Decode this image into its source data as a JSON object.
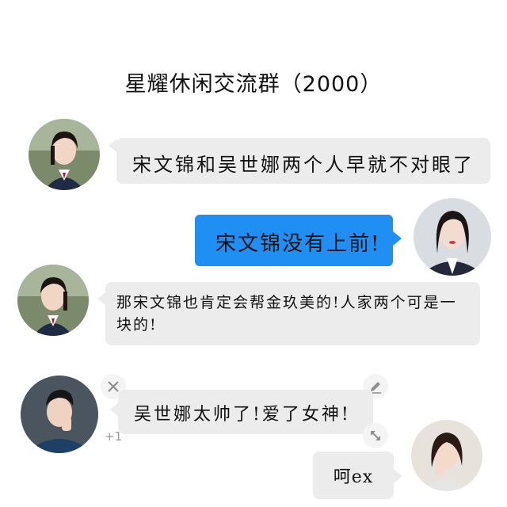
{
  "header": {
    "title": "星耀休闲交流群（2000）"
  },
  "messages": [
    {
      "side": "left",
      "text": "宋文锦和吴世娜两个人早就不对眼了"
    },
    {
      "side": "right",
      "text": "宋文锦没有上前!"
    },
    {
      "side": "left",
      "text": "那宋文锦也肯定会帮金玖美的!人家两个可是一块的!"
    },
    {
      "side": "left",
      "text": "吴世娜太帅了!爱了女神!"
    },
    {
      "side": "right",
      "text": "呵ex"
    }
  ],
  "controls": {
    "close_icon": "close-icon",
    "edit_icon": "pencil-icon",
    "resize_icon": "resize-icon",
    "plus_one": "+1"
  },
  "colors": {
    "blue_bubble": "#1f8ff4",
    "gray_bubble": "#ececec"
  }
}
